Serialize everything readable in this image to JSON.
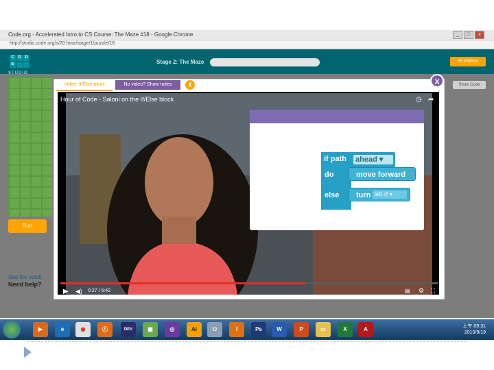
{
  "browser": {
    "window_title": "Code.org - Accelerated Intro to CS Course: The Maze #18 - Google Chrome",
    "url": "http://studio.code.org/s/20 hour/stage/1/puzzle/18"
  },
  "codeorg_header": {
    "logo_letters": [
      "C",
      "O",
      "D",
      "E",
      "",
      ""
    ],
    "studio_label": "STUDIO",
    "stage_title": "Stage 2: The Maze",
    "hi_button": "Hi Videos"
  },
  "left_panel": {
    "run_button": "Run",
    "see_solution": "See the soluti",
    "need_help": "Need help?"
  },
  "show_code_button": "Show Code",
  "modal": {
    "tab_video": "Video: If/Else block",
    "tab_notes": "No video? Show notes",
    "close_label": "X",
    "video_title": "Hour of Code - Saloni on the If/Else block",
    "time_display": "0:27 / 6:42",
    "progress_fraction": 0.65
  },
  "blockly": {
    "if_label": "if path",
    "condition": "ahead ▾",
    "do_label": "do",
    "move_block": "move forward",
    "else_label": "else",
    "turn_block": "turn",
    "turn_dir": "left ↺ ▾"
  },
  "taskbar": {
    "clock_time": "上午 09:31",
    "clock_date": "2015/9/19"
  },
  "colors": {
    "code_teal": "#00656f",
    "orange": "#ffa400",
    "purple": "#7e5ca2",
    "block_blue": "#27a0c6"
  }
}
